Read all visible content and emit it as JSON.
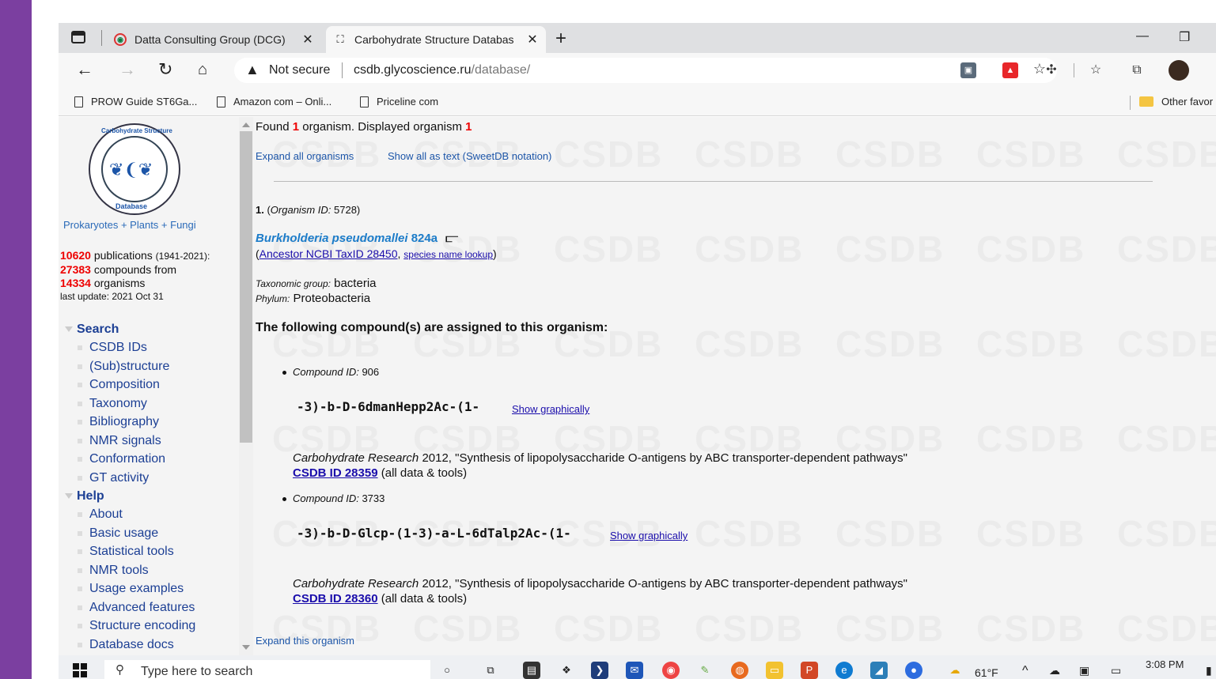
{
  "browser": {
    "tabs": [
      {
        "label": "Datta Consulting Group (DCG)",
        "active": false
      },
      {
        "label": "Carbohydrate Structure Databas",
        "active": true
      }
    ],
    "address": {
      "security_label": "Not secure",
      "url_host": "csdb.glycoscience.ru",
      "url_path": "/database/"
    },
    "bookmarks": [
      "PROW Guide ST6Ga...",
      "Amazon com – Onli...",
      "Priceline com"
    ],
    "other_favorites": "Other favor"
  },
  "sidebar": {
    "logo_top_text": "Carbohydrate Structure",
    "logo_bottom_text": "Database",
    "tagline": "Prokaryotes + Plants + Fungi",
    "stats": {
      "publications_count": "10620",
      "publications_label": "publications",
      "publications_range": "(1941-2021):",
      "compounds_count": "27383",
      "compounds_label": "compounds from",
      "organisms_count": "14334",
      "organisms_label": "organisms",
      "last_update": "last update: 2021 Oct 31"
    },
    "menu": {
      "search_label": "Search",
      "search_items": [
        "CSDB IDs",
        "(Sub)structure",
        "Composition",
        "Taxonomy",
        "Bibliography",
        "NMR signals",
        "Conformation",
        "GT activity"
      ],
      "help_label": "Help",
      "help_items": [
        "About",
        "Basic usage",
        "Statistical tools",
        "NMR tools",
        "Usage examples",
        "Advanced features",
        "Structure encoding",
        "Database docs"
      ]
    }
  },
  "main": {
    "found_prefix": "Found",
    "found_count": "1",
    "found_mid": "organism. Displayed organism",
    "displayed_count": "1",
    "expand_all": "Expand all organisms",
    "show_all_text": "Show all as text (SweetDB notation)",
    "org_index": "1.",
    "org_id_label": "Organism ID:",
    "org_id": "5728",
    "org_name": "Burkholderia pseudomallei",
    "org_strain": "824a",
    "ancestor_link": "Ancestor NCBI TaxID 28450",
    "species_lookup": "species name lookup",
    "taxgroup_label": "Taxonomic group:",
    "taxgroup": "bacteria",
    "phylum_label": "Phylum:",
    "phylum": "Proteobacteria",
    "compounds_heading": "The following compound(s) are assigned to this organism:",
    "compounds": [
      {
        "id_label": "Compound ID:",
        "id": "906",
        "structure": "-3)-b-D-6dmanHepp2Ac-(1-",
        "show_graphically": "Show graphically",
        "journal": "Carbohydrate Research",
        "citation": "2012, \"Synthesis of lipopolysaccharide O-antigens by ABC transporter-dependent pathways\"",
        "csdb_link": "CSDB ID 28359",
        "tools": "(all data & tools)"
      },
      {
        "id_label": "Compound ID:",
        "id": "3733",
        "structure": "-3)-b-D-Glcp-(1-3)-a-L-6dTalp2Ac-(1-",
        "show_graphically": "Show graphically",
        "journal": "Carbohydrate Research",
        "citation": "2012, \"Synthesis of lipopolysaccharide O-antigens by ABC transporter-dependent pathways\"",
        "csdb_link": "CSDB ID 28360",
        "tools": "(all data & tools)"
      }
    ],
    "expand_this": "Expand this organism",
    "watermark": "CSDB"
  },
  "taskbar": {
    "search_placeholder": "Type here to search",
    "weather": "61°F",
    "time": "3:08 PM"
  },
  "colors": {
    "accent_purple": "#7b3fa0",
    "count_red": "#e00000",
    "menu_blue": "#1c3f94",
    "organism_blue": "#1c7cc9"
  }
}
